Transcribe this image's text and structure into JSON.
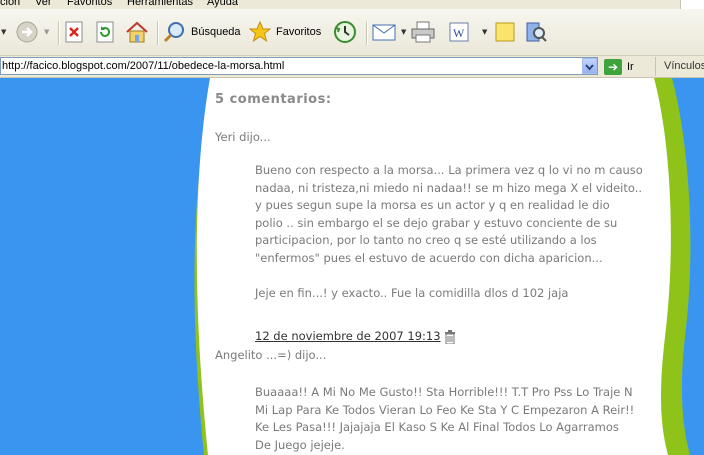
{
  "menu": [
    "ción",
    "Ver",
    "Favoritos",
    "Herramientas",
    "Ayuda"
  ],
  "toolbar": {
    "search_label": "Búsqueda",
    "favorites_label": "Favoritos"
  },
  "address": {
    "url": "http://facico.blogspot.com/2007/11/obedece-la-morsa.html",
    "go_label": "Ir",
    "links_label": "Vínculos"
  },
  "colors": {
    "background": "#3a95f0",
    "wave": "#8fc319",
    "page": "#ffffff"
  },
  "post": {
    "comments_heading": "5 comentarios:",
    "comments": [
      {
        "author_line": "Yeri dijo...",
        "lines": [
          "Bueno con respecto a la morsa... La primera vez q lo vi no m causo",
          "nadaa, ni tristeza,ni miedo ni nadaa!! se m hizo mega X el videito..",
          "y pues segun supe la morsa es un actor y q en realidad le dio",
          "polio .. sin embargo el se dejo grabar y estuvo conciente de su",
          "participacion, por lo tanto no creo q se esté utilizando a los",
          "\"enfermos\" pues el estuvo de acuerdo con dicha aparicion...",
          "",
          "Jeje en fin...! y exacto.. Fue la comidilla dlos d 102 jaja"
        ],
        "timestamp": "12 de noviembre de 2007 19:13"
      },
      {
        "author_line": "Angelito ...=) dijo...",
        "lines": [
          "Buaaaa!! A Mi No Me Gusto!! Sta Horrible!!! T.T Pro Pss Lo Traje N",
          "Mi Lap Para Ke Todos Vieran Lo Feo Ke Sta Y C Empezaron A Reir!!",
          "Ke Les Pasa!!! Jajajaja El Kaso S Ke Al Final Todos Lo Agarramos",
          "De Juego jejeje."
        ]
      }
    ]
  }
}
